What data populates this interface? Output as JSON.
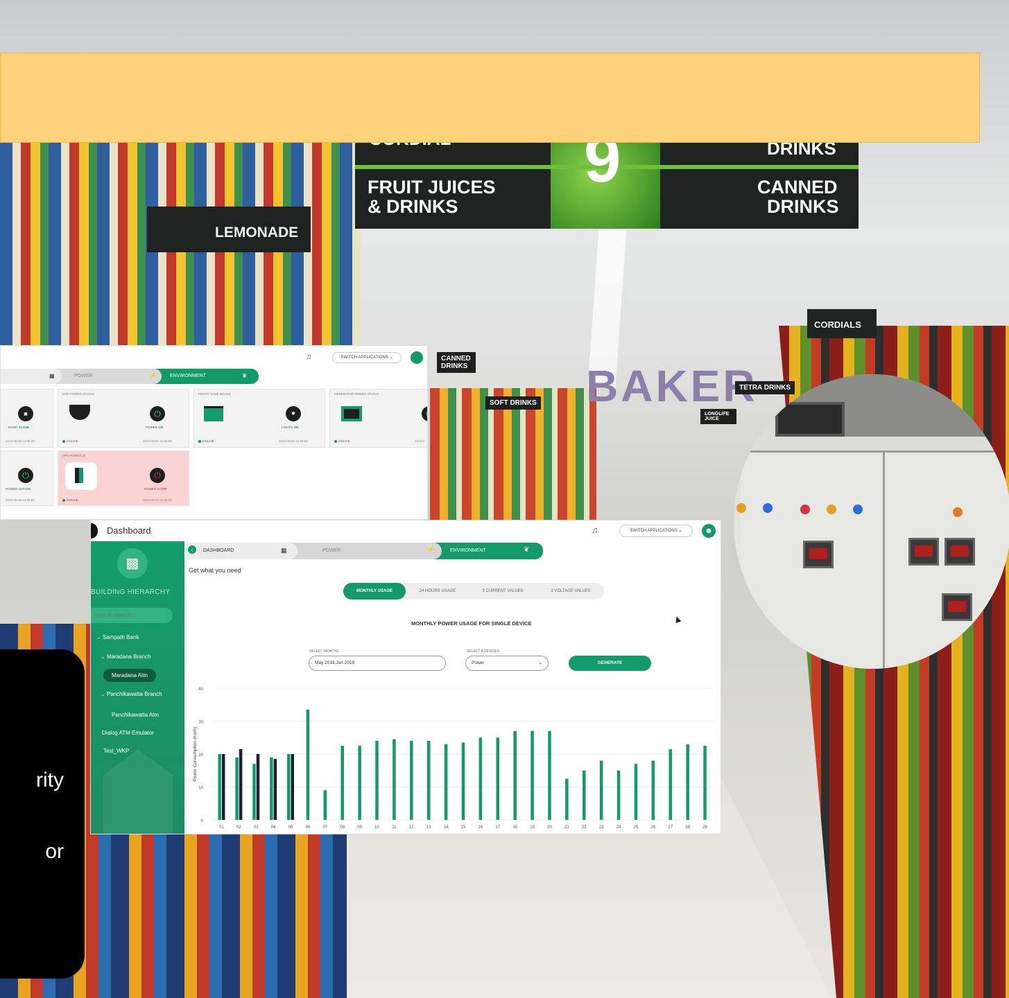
{
  "background": {
    "signs": {
      "cordial": "CORDIAL",
      "drinks_top": "DRINKS",
      "fruit_juices_1": "FRUIT JUICES",
      "fruit_juices_2": "& DRINKS",
      "aisle_number": "9",
      "canned_1": "CANNED",
      "canned_2": "DRINKS",
      "lemonade": "LEMONADE",
      "cordials": "CORDIALS",
      "bake": "BAKER",
      "tetra": "TETRA DRINKS",
      "soft": "SOFT DRINKS",
      "canned_small": "CANNED DRINKS",
      "longlife": "LONGLIFE JUICE"
    },
    "accent_banner": "#fed37c"
  },
  "black_panel": {
    "lines": [
      "rity",
      "or"
    ]
  },
  "shot1": {
    "switch_label": "SWITCH APPLICATIONS",
    "tabs": {
      "power": "POWER",
      "environment": "ENVIRONMENT"
    },
    "cards": [
      {
        "door_label": "DOOR",
        "door_state": "CLOSE",
        "timestamp": "2019-06-06 13:08:59"
      },
      {
        "title": "DVR POWER STATUS",
        "status": "ONLINE",
        "power_label": "POWER",
        "power_state": "ON",
        "timestamp": "2019-06-06 13:08:59"
      },
      {
        "title": "FRONT NAME BOARD",
        "status": "ONLINE",
        "lights_label": "LIGHTS",
        "lights_state": "ON",
        "timestamp": "2019-06-06 13:08:59"
      },
      {
        "title": "GENERATOR POWER STATUS",
        "status": "ONLINE",
        "timestamp": "2019-0"
      },
      {
        "power_out_label": "POWER OUT",
        "power_out_state": "ON",
        "timestamp": "2019-06-06 13:08:59"
      },
      {
        "title": "UPS POWER IN",
        "status": "ONLINE",
        "power_in_label": "POWER IN",
        "power_in_state": "OFF",
        "timestamp": "2019-06-06 13:08:59"
      }
    ]
  },
  "shot2": {
    "title": "Dashboard",
    "switch_label": "SWITCH APPLICATIONS",
    "crumbs": {
      "dashboard": "DASHBOARD",
      "power": "POWER",
      "environment": "ENVIRONMENT"
    },
    "sidebar": {
      "hierarchy_label": "BUILDING HIERARCHY",
      "search_placeholder": "Type to search...",
      "items": [
        {
          "label": "Sampath Bank"
        },
        {
          "label": "Maradana Branch"
        },
        {
          "label": "Maradana Atm"
        },
        {
          "label": "Panchikawatta Branch"
        },
        {
          "label": "Panchikawatta Atm"
        },
        {
          "label": "Dialog ATM Emulator"
        },
        {
          "label": "Test_WKP"
        }
      ]
    },
    "subtitle": "Get what you need",
    "usage_tabs": [
      "MONTHLY USAGE",
      "24 HOURS USAGE",
      "3 CURRENT VALUES",
      "3 VOLTAGE VALUES"
    ],
    "chart_title": "MONTHLY POWER USAGE FOR SINGLE DEVICE",
    "select_months_label": "SELECT MONTHS",
    "select_months_value": "May 2019,Jun 2019",
    "select_device_label": "SELECT A DEVICES",
    "select_device_value": "Power",
    "generate_label": "GENERATE"
  },
  "chart_data": {
    "type": "bar",
    "ylabel": "Power Consumption (Kw/h)",
    "ylim": [
      0,
      40
    ],
    "yticks": [
      0,
      10,
      20,
      30,
      40
    ],
    "categories": [
      "01",
      "02",
      "03",
      "04",
      "05",
      "06",
      "07",
      "08",
      "09",
      "10",
      "11",
      "12",
      "13",
      "14",
      "15",
      "16",
      "17",
      "18",
      "19",
      "20",
      "21",
      "22",
      "23",
      "24",
      "25",
      "26",
      "27",
      "28",
      "29"
    ],
    "series": [
      {
        "color": "#129a6b",
        "values": [
          20,
          19,
          17,
          19,
          20,
          33.5,
          9,
          22.5,
          22.5,
          24,
          24.5,
          24,
          24,
          23,
          23.5,
          25,
          25,
          27,
          27,
          27,
          12.5,
          15,
          18,
          15,
          17,
          18,
          21.5,
          23,
          22.5
        ]
      },
      {
        "color": "#1c1d33",
        "values": [
          20,
          21.5,
          20,
          18.5,
          20,
          null,
          null,
          null,
          null,
          null,
          null,
          null,
          null,
          null,
          null,
          null,
          null,
          null,
          null,
          null,
          null,
          null,
          null,
          null,
          null,
          null,
          null,
          null,
          null
        ]
      }
    ],
    "grid": true,
    "legend": "none"
  }
}
